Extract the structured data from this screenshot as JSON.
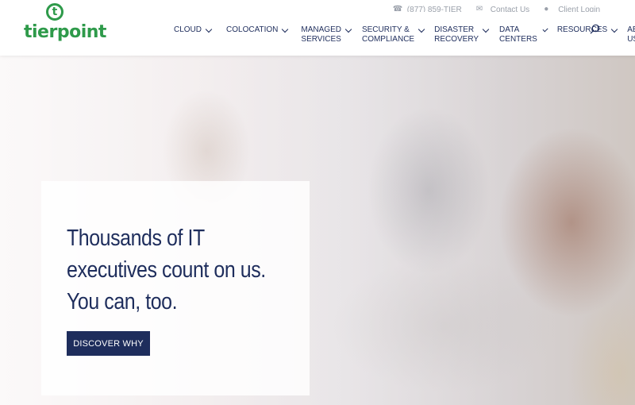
{
  "header": {
    "logo_text": "tierpoint",
    "logo_mark": "t",
    "utility": [
      {
        "icon": "phone-icon",
        "label": "(877) 859-TIER"
      },
      {
        "icon": "mail-icon",
        "label": "Contact Us"
      },
      {
        "icon": "user-icon",
        "label": "Client Login"
      }
    ],
    "nav": [
      {
        "label": "CLOUD"
      },
      {
        "label": "COLOCATION"
      },
      {
        "label": "MANAGED\nSERVICES"
      },
      {
        "label": "SECURITY &\nCOMPLIANCE"
      },
      {
        "label": "DISASTER\nRECOVERY"
      },
      {
        "label": "DATA CENTERS"
      },
      {
        "label": "RESOURCES"
      },
      {
        "label": "ABOUT US"
      }
    ],
    "search_icon": "search-icon"
  },
  "hero": {
    "headline": "Thousands of IT\nexecutives count on us.\nYou can, too.",
    "cta_label": "DISCOVER WHY"
  },
  "colors": {
    "brand_green": "#2e9a4a",
    "navy": "#1e2d5c"
  }
}
